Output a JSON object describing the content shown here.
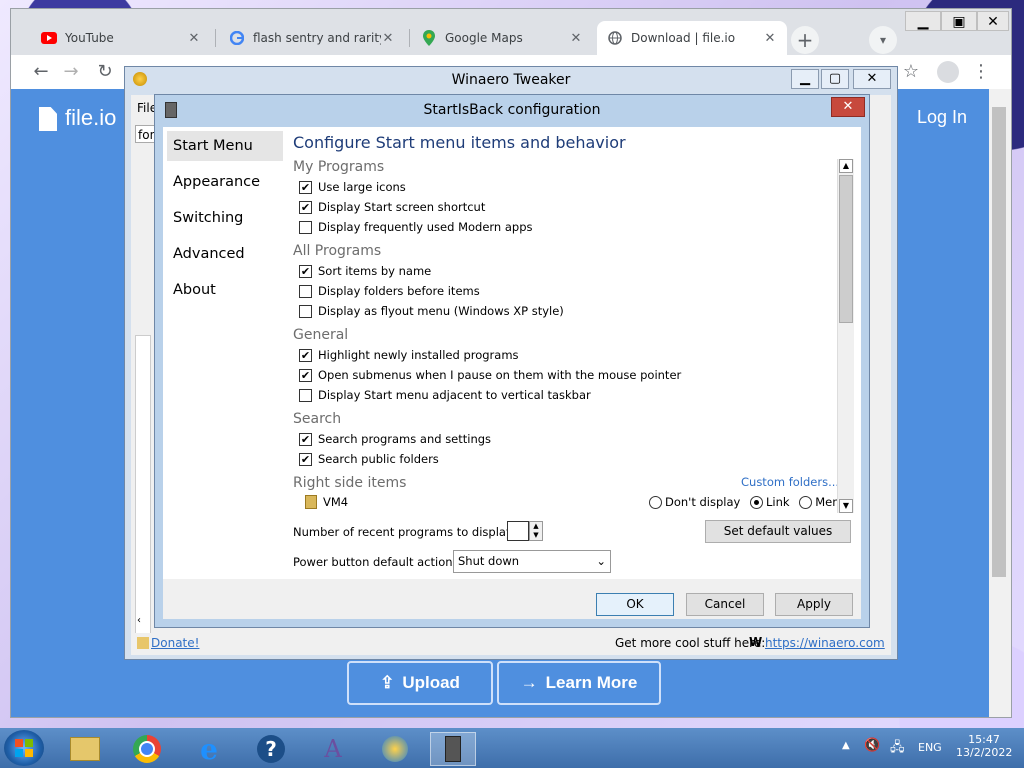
{
  "browser": {
    "tabs": [
      {
        "title": "YouTube",
        "icon": "youtube-icon"
      },
      {
        "title": "flash sentry and rarity -",
        "icon": "google-icon"
      },
      {
        "title": "Google Maps",
        "icon": "google-maps-icon"
      },
      {
        "title": "Download | file.io",
        "icon": "globe-icon",
        "active": true
      }
    ],
    "new_tab_label": "+",
    "close_glyph": "✕"
  },
  "page": {
    "brand": "file.io",
    "login": "Log In",
    "upload_button": "Upload",
    "learn_more_button": "Learn More"
  },
  "winaero": {
    "title": "Winaero Tweaker",
    "menu_fragment": "File",
    "search_fragment": "fon",
    "donate": "Donate!",
    "more_stuff": "Get more cool stuff here:",
    "site_link": "https://winaero.com"
  },
  "sib": {
    "title": "StartIsBack configuration",
    "nav": [
      "Start Menu",
      "Appearance",
      "Switching",
      "Advanced",
      "About"
    ],
    "heading": "Configure Start menu items and behavior",
    "sections": {
      "my_programs": "My Programs",
      "all_programs": "All Programs",
      "general": "General",
      "search": "Search",
      "right_side": "Right side items"
    },
    "options": {
      "use_large_icons": {
        "label": "Use large icons",
        "checked": true
      },
      "start_screen_shortcut": {
        "label": "Display Start screen shortcut",
        "checked": true
      },
      "frequent_modern": {
        "label": "Display frequently used Modern apps",
        "checked": false
      },
      "sort_by_name": {
        "label": "Sort items by name",
        "checked": true
      },
      "folders_before": {
        "label": "Display folders before items",
        "checked": false
      },
      "flyout_menu": {
        "label": "Display as flyout menu (Windows XP style)",
        "checked": false
      },
      "highlight_new": {
        "label": "Highlight newly installed programs",
        "checked": true
      },
      "open_submenus": {
        "label": "Open submenus when I pause on them with the mouse pointer",
        "checked": true
      },
      "adjacent_taskbar": {
        "label": "Display Start menu adjacent to vertical taskbar",
        "checked": false
      },
      "search_programs": {
        "label": "Search programs and settings",
        "checked": true
      },
      "search_public": {
        "label": "Search public folders",
        "checked": true
      }
    },
    "custom_folders": "Custom folders...",
    "right_item": "VM4",
    "radio_options": [
      "Don't display",
      "Link",
      "Menu"
    ],
    "radio_selected": "Link",
    "recent_label": "Number of recent programs to display:",
    "recent_value": "",
    "set_defaults": "Set default values",
    "power_label": "Power button default action:",
    "power_value": "Shut down",
    "ok": "OK",
    "cancel": "Cancel",
    "apply": "Apply"
  },
  "taskbar": {
    "language": "ENG",
    "time": "15:47",
    "date": "13/2/2022"
  }
}
